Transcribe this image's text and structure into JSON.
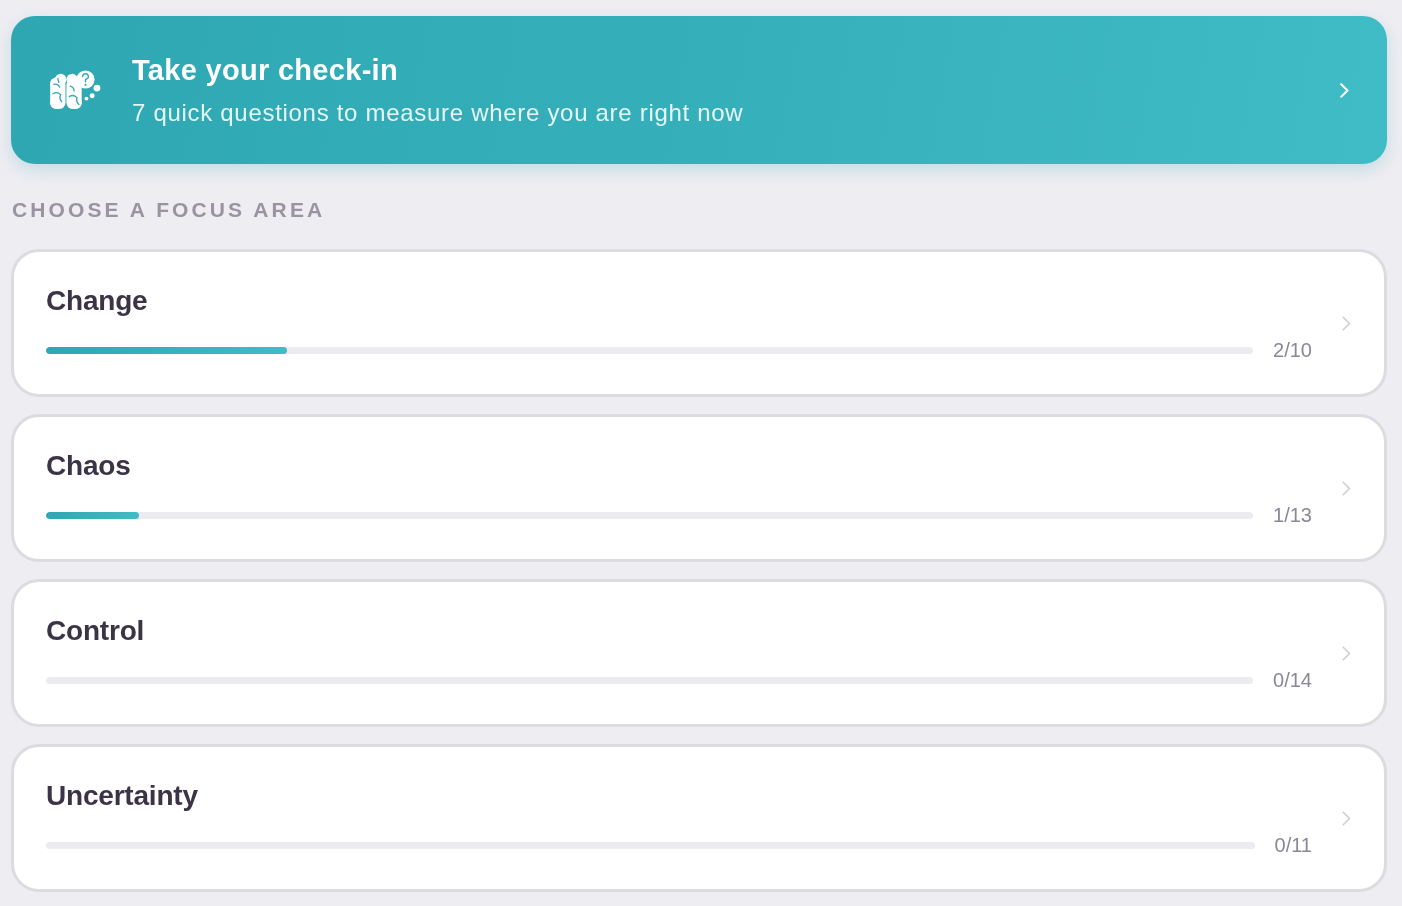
{
  "checkin_banner": {
    "title": "Take your check-in",
    "subtitle": "7 quick questions to measure where you are right now"
  },
  "section_heading": "CHOOSE A FOCUS AREA",
  "focus_areas": [
    {
      "title": "Change",
      "level": 0.2,
      "count": "2/10"
    },
    {
      "title": "Chaos",
      "level": 0.077,
      "count": "1/13"
    },
    {
      "title": "Control",
      "count": "0/14"
    },
    {
      "title": "Uncertainty",
      "count": "0/11"
    }
  ]
}
